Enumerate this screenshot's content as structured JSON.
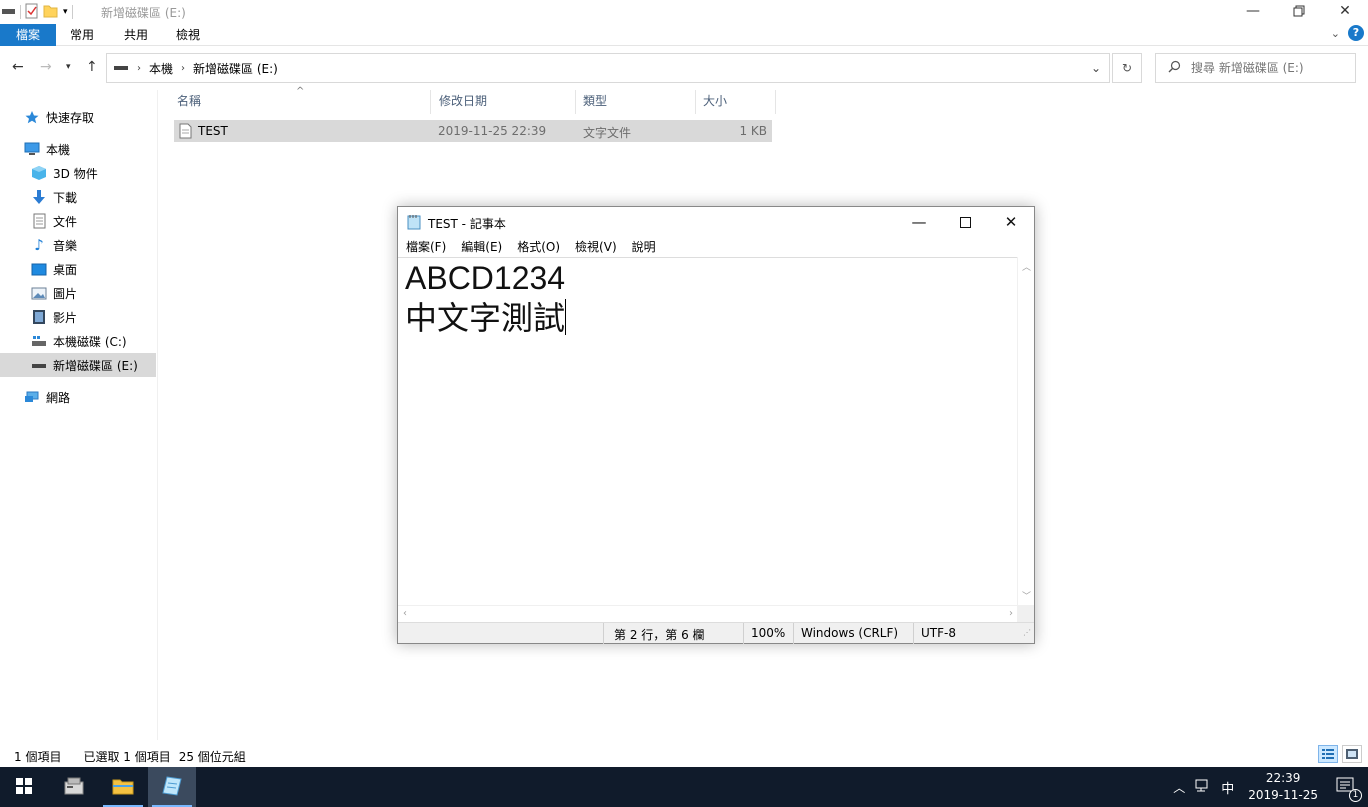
{
  "explorer": {
    "window_title": "新增磁碟區 (E:)",
    "ribbon_tabs": [
      "檔案",
      "常用",
      "共用",
      "檢視"
    ],
    "address": {
      "crumbs": [
        "本機",
        "新增磁碟區 (E:)"
      ]
    },
    "search": {
      "placeholder": "搜尋 新增磁碟區 (E:)"
    },
    "nav_pane": {
      "quick_access": "快速存取",
      "this_pc": "本機",
      "items": [
        "3D 物件",
        "下載",
        "文件",
        "音樂",
        "桌面",
        "圖片",
        "影片",
        "本機磁碟 (C:)",
        "新增磁碟區 (E:)"
      ],
      "network": "網路"
    },
    "columns": {
      "name": "名稱",
      "date": "修改日期",
      "type": "類型",
      "size": "大小"
    },
    "files": [
      {
        "name": "TEST",
        "date": "2019-11-25 22:39",
        "type": "文字文件",
        "size": "1 KB"
      }
    ],
    "status": {
      "count": "1 個項目",
      "selected": "已選取 1 個項目",
      "bytes": "25 個位元組"
    }
  },
  "notepad": {
    "title": "TEST - 記事本",
    "menu": [
      "檔案(F)",
      "編輯(E)",
      "格式(O)",
      "檢視(V)",
      "說明"
    ],
    "content": {
      "line1": "ABCD1234",
      "line2": "中文字測試"
    },
    "status": {
      "position": "第 2 行，第 6 欄",
      "zoom": "100%",
      "line_ending": "Windows (CRLF)",
      "encoding": "UTF-8"
    }
  },
  "taskbar": {
    "tray_ime": "中",
    "time": "22:39",
    "date": "2019-11-25",
    "notification_count": "1"
  }
}
